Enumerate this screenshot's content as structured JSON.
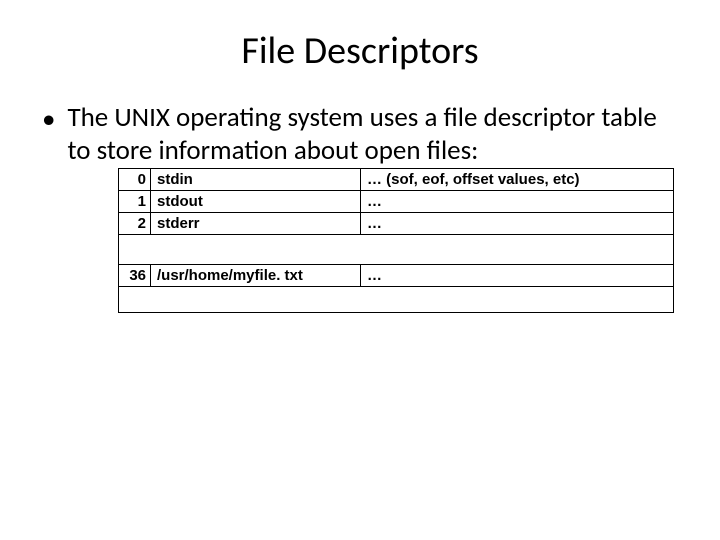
{
  "title": "File Descriptors",
  "bullet_marker": "•",
  "bullet_text": "The UNIX operating system uses a file descriptor table to store information about open files:",
  "rows": {
    "r0": {
      "fd": "0",
      "name": "stdin",
      "info": "… (sof, eof, offset values, etc)"
    },
    "r1": {
      "fd": "1",
      "name": "stdout",
      "info": "…"
    },
    "r2": {
      "fd": "2",
      "name": "stderr",
      "info": "…"
    },
    "r36": {
      "fd": "36",
      "name": "/usr/home/myfile. txt",
      "info": "…"
    }
  }
}
